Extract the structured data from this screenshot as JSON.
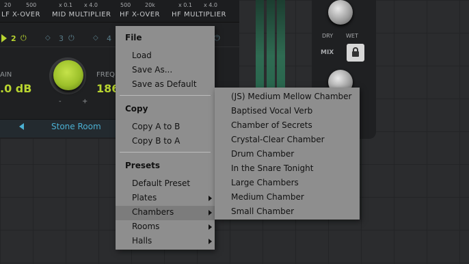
{
  "crossover": {
    "lf_vals": [
      "20",
      "500"
    ],
    "lf_label": "LF X-OVER",
    "mid_vals": [
      "x 0.1",
      "x 4.0"
    ],
    "mid_label": "MID MULTIPLIER",
    "hf_vals": [
      "500",
      "20k"
    ],
    "hf_label": "HF X-OVER",
    "hfm_vals": [
      "x 0.1",
      "x 4.0"
    ],
    "hfm_label": "HF MULTIPLIER"
  },
  "bands": [
    "2",
    "3",
    "4"
  ],
  "params": {
    "gain_label": "AIN",
    "gain_value": ".0 dB",
    "freq_label": "FREQ",
    "freq_value": "186",
    "knob_min": "-",
    "knob_max": "+"
  },
  "preset": {
    "name": "Stone Room"
  },
  "mix": {
    "dry": "DRY",
    "wet": "WET",
    "label": "MIX"
  },
  "menu": {
    "file_header": "File",
    "load": "Load",
    "save_as": "Save As...",
    "save_default": "Save as Default",
    "copy_header": "Copy",
    "copy_a_b": "Copy A to B",
    "copy_b_a": "Copy B to A",
    "presets_header": "Presets",
    "default_preset": "Default Preset",
    "plates": "Plates",
    "chambers": "Chambers",
    "rooms": "Rooms",
    "halls": "Halls"
  },
  "submenu": {
    "items": [
      "(JS) Medium Mellow Chamber",
      "Baptised Vocal Verb",
      "Chamber of Secrets",
      "Crystal-Clear Chamber",
      "Drum Chamber",
      "In the Snare Tonight",
      "Large Chambers",
      "Medium Chamber",
      "Small Chamber"
    ]
  },
  "colors": {
    "accent_green": "#b8d430",
    "accent_blue": "#4bb0d2",
    "menu_bg": "#8e8e8e",
    "menu_highlight": "#7c7c7c"
  }
}
